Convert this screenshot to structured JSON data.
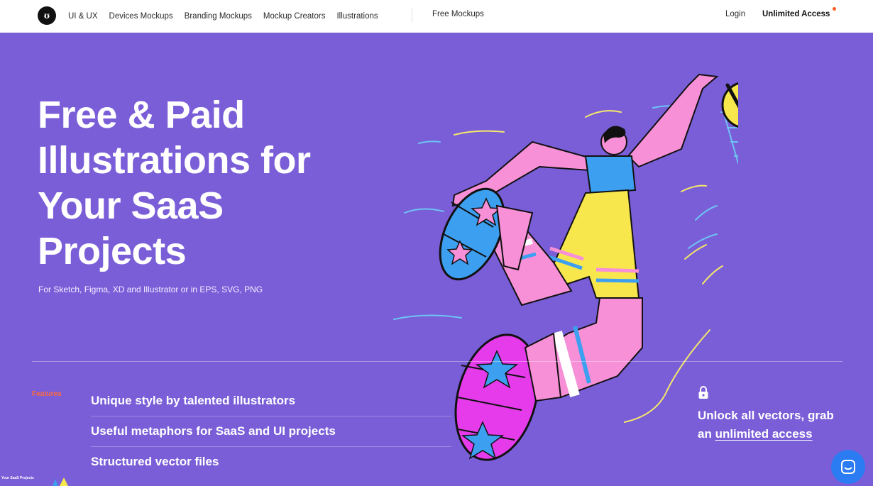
{
  "nav": {
    "logo_glyph": "ʊ",
    "links": [
      "UI & UX",
      "Devices Mockups",
      "Branding Mockups",
      "Mockup Creators",
      "Illustrations"
    ],
    "free_mockups": "Free Mockups",
    "login": "Login",
    "unlimited_access": "Unlimited Access"
  },
  "hero": {
    "title": "Free & Paid Illustrations for Your SaaS Projects",
    "subtitle": "For Sketch, Figma, XD and Illustrator or in EPS, SVG, PNG"
  },
  "features": {
    "tag": "Features",
    "items": [
      "Unique style by talented illustrators",
      "Useful metaphors for SaaS and UI projects",
      "Structured vector files"
    ]
  },
  "unlock": {
    "prefix": "Unlock all vectors, grab an ",
    "link": "unlimited access"
  },
  "thumbnail": {
    "text": "Your SaaS Projects"
  },
  "colors": {
    "hero_bg": "#7a5ed8",
    "features_tag": "#ff6a3d",
    "chat_button": "#2b7bf2",
    "notification_dot": "#ff5a1f"
  },
  "icons": {
    "lock": "lock-icon",
    "chat": "chat-icon",
    "logo": "logo-icon"
  }
}
